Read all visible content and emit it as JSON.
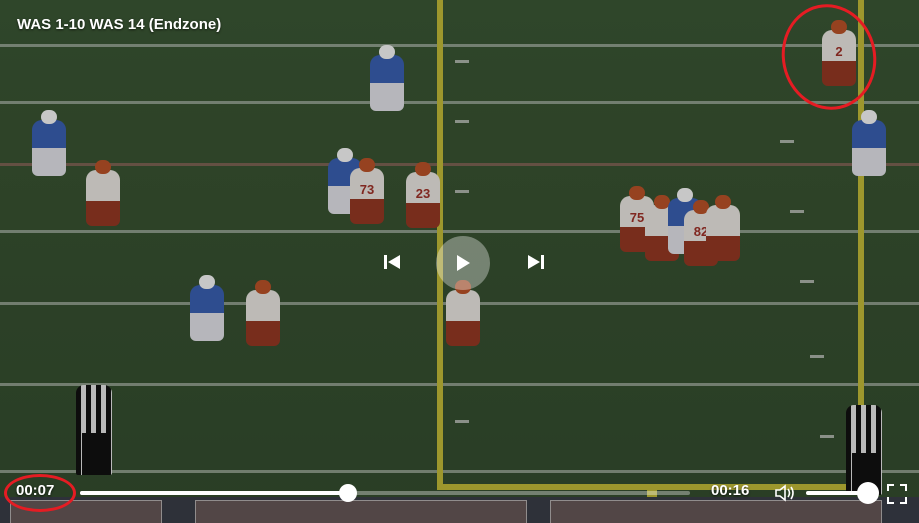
{
  "video": {
    "title": "WAS  1-10  WAS 14 (Endzone)",
    "current_time": "00:07",
    "duration": "00:16",
    "progress": 0.44,
    "volume": 1.0
  },
  "players": {
    "home_numbers": [
      "73",
      "23",
      "75",
      "82",
      "2"
    ]
  },
  "colors": {
    "annotation": "#e51c23",
    "goalpost": "#c9c23a",
    "home_jersey": "#f2efe9",
    "away_jersey": "#3c63b8"
  },
  "icons": {
    "play": "play-icon",
    "previous": "skip-previous-icon",
    "next": "skip-next-icon",
    "volume": "volume-icon",
    "fullscreen": "fullscreen-icon"
  }
}
